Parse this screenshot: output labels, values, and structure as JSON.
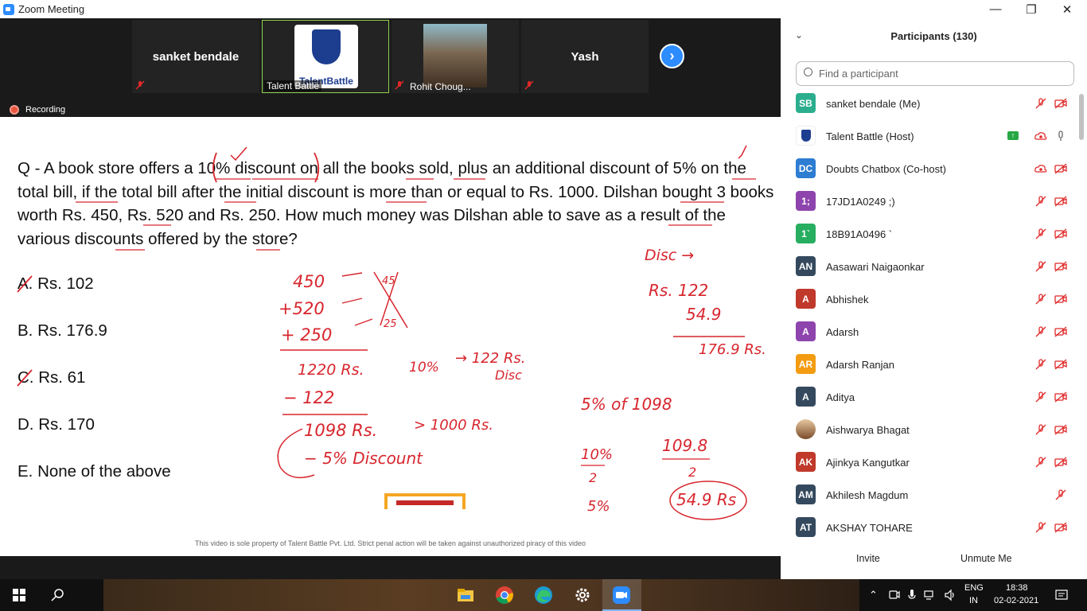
{
  "window": {
    "title": "Zoom Meeting",
    "minimize": "—",
    "restore": "❐",
    "close": "✕"
  },
  "video_strip": {
    "tiles": [
      {
        "name": "sanket bendale"
      },
      {
        "label": "Talent Battle",
        "logo_text": "TalentBattle"
      },
      {
        "label": "Rohit Choug..."
      },
      {
        "name": "Yash"
      }
    ],
    "recording_label": "Recording"
  },
  "slide": {
    "question": "Q - A book store offers a 10% discount on all the books sold, plus an additional discount of 5% on the total bill, if the total bill after the initial discount is more than or equal to Rs. 1000. Dilshan bought 3 books worth Rs. 450, Rs. 520 and Rs. 250. How much money was Dilshan able to save as a result of the various discounts offered by the store?",
    "options": [
      "A. Rs. 102",
      "B. Rs. 176.9",
      "C. Rs. 61",
      "D. Rs. 170",
      "E. None of the above"
    ],
    "footer": "This video is sole property of Talent Battle Pvt. Ltd. Strict penal action will be taken against unauthorized piracy of this video",
    "handwriting": {
      "a1": "450",
      "a2": "+520",
      "a3": "+ 250",
      "sum": "1220 Rs.",
      "minus": "− 122",
      "res": "1098 Rs.",
      "disc5": "− 5% Discount",
      "gt": "> 1000 Rs.",
      "ten": "10%",
      "arrow122": "→ 122 Rs.",
      "disc": "Disc",
      "five_of": "5% of 1098",
      "ten_half": "10%",
      "two1": "2",
      "five": "5%",
      "v1098": "109.8",
      "two2": "2",
      "circ": "54.9 Rs",
      "disc_arrow": "Disc →",
      "r122": "Rs. 122",
      "r549": "54.9",
      "r1769": "176.9 Rs."
    }
  },
  "participants": {
    "title": "Participants (130)",
    "search_placeholder": "Find a participant",
    "invite": "Invite",
    "unmute_me": "Unmute Me",
    "items": [
      {
        "initials": "SB",
        "color": "#2bae8e",
        "name": "sanket bendale (Me)"
      },
      {
        "initials": "",
        "color": "#ffffff",
        "name": "Talent Battle (Host)"
      },
      {
        "initials": "DC",
        "color": "#2d7dd2",
        "name": "Doubts Chatbox (Co-host)"
      },
      {
        "initials": "1;",
        "color": "#8e44ad",
        "name": "17JD1A0249 ;)"
      },
      {
        "initials": "1`",
        "color": "#27ae60",
        "name": "18B91A0496 `"
      },
      {
        "initials": "AN",
        "color": "#34495e",
        "name": "Aasawari Naigaonkar"
      },
      {
        "initials": "A",
        "color": "#c0392b",
        "name": "Abhishek"
      },
      {
        "initials": "A",
        "color": "#8e44ad",
        "name": "Adarsh"
      },
      {
        "initials": "AR",
        "color": "#f39c12",
        "name": "Adarsh Ranjan"
      },
      {
        "initials": "A",
        "color": "#34495e",
        "name": "Aditya"
      },
      {
        "initials": "",
        "color": "#d4a373",
        "name": "Aishwarya Bhagat"
      },
      {
        "initials": "AK",
        "color": "#c0392b",
        "name": "Ajinkya Kangutkar"
      },
      {
        "initials": "AM",
        "color": "#34495e",
        "name": "Akhilesh Magdum"
      },
      {
        "initials": "AT",
        "color": "#34495e",
        "name": "AKSHAY TOHARE"
      }
    ]
  },
  "taskbar": {
    "lang1": "ENG",
    "lang2": "IN",
    "time": "18:38",
    "date": "02-02-2021"
  }
}
